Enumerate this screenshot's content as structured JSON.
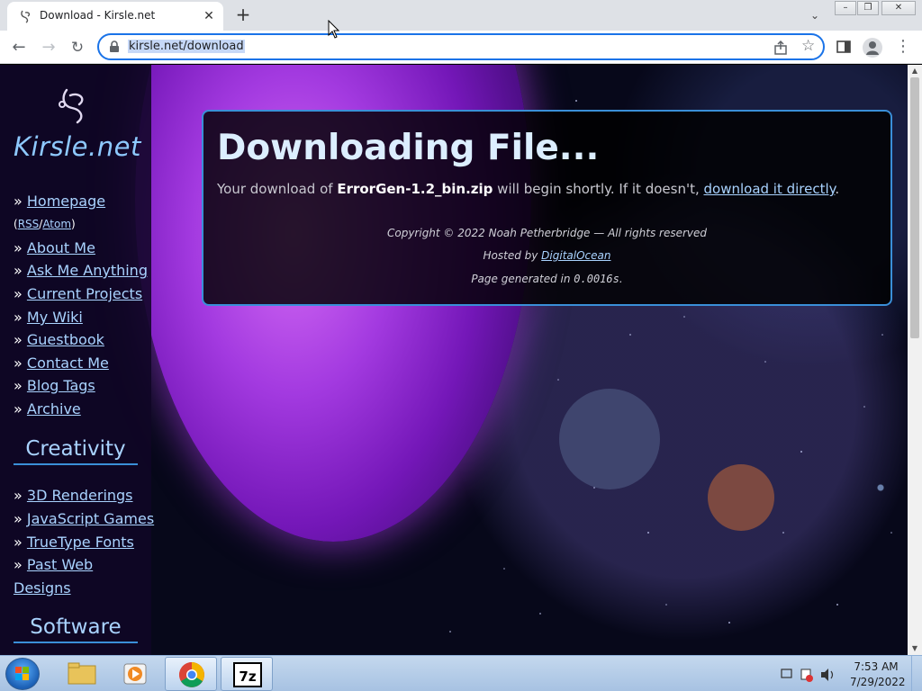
{
  "browser": {
    "tab_title": "Download - Kirsle.net",
    "new_tab_symbol": "+",
    "url": "kirsle.net/download"
  },
  "site": {
    "logo_text": "Kirsle.net",
    "nav_arrow": "»",
    "nav": [
      {
        "label": "Homepage"
      },
      {
        "label": "RSS"
      },
      {
        "label": "Atom"
      },
      {
        "label": "About Me"
      },
      {
        "label": "Ask Me Anything"
      },
      {
        "label": "Current Projects"
      },
      {
        "label": "My Wiki"
      },
      {
        "label": "Guestbook"
      },
      {
        "label": "Contact Me"
      },
      {
        "label": "Blog Tags"
      },
      {
        "label": "Archive"
      }
    ],
    "creativity_heading": "Creativity",
    "creativity": [
      {
        "label": "3D Renderings"
      },
      {
        "label": "JavaScript Games"
      },
      {
        "label": "TrueType Fonts"
      },
      {
        "label": "Past Web"
      },
      {
        "label": "Designs"
      }
    ],
    "software_heading": "Software"
  },
  "download": {
    "title": "Downloading File...",
    "msg_prefix": "Your download of ",
    "filename": "ErrorGen-1.2_bin.zip",
    "msg_middle": " will begin shortly. If it doesn't, ",
    "direct_link": "download it directly",
    "msg_suffix": ".",
    "copyright": "Copyright © 2022 Noah Petherbridge — All rights reserved",
    "hosted_prefix": "Hosted by ",
    "host_link": "DigitalOcean",
    "generated_prefix": "Page generated in ",
    "generated_time": "0.0016s",
    "generated_suffix": "."
  },
  "taskbar": {
    "time": "7:53 AM",
    "date": "7/29/2022",
    "apps": [
      "windows-explorer",
      "media-player",
      "google-chrome",
      "7-zip"
    ],
    "active_app": "google-chrome"
  },
  "colors": {
    "link": "#a9d3ff",
    "accent_border": "#3a8fd8",
    "planet": "#a33ae0",
    "omnibox_focus": "#1a73e8"
  }
}
